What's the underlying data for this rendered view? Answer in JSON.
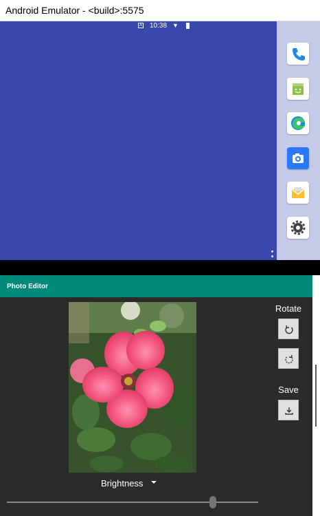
{
  "window": {
    "title": "Android Emulator - <build>:5575"
  },
  "status_bar": {
    "time": "10:38",
    "notification_glyph": "A",
    "icons": [
      "wifi-icon",
      "battery-icon"
    ]
  },
  "dock": {
    "apps": [
      {
        "name": "phone-app-icon",
        "color": "#1e88e5"
      },
      {
        "name": "store-app-icon",
        "color": "#8bc34a"
      },
      {
        "name": "edge-browser-app-icon",
        "color": "#0f8de0"
      },
      {
        "name": "camera-app-icon",
        "color": "#2979ff"
      },
      {
        "name": "mail-app-icon",
        "color": "#fbc02d"
      },
      {
        "name": "settings-app-icon",
        "color": "#424242"
      }
    ]
  },
  "app": {
    "title": "Photo Editor",
    "accent": "#00897b",
    "rotate_label": "Rotate",
    "save_label": "Save",
    "brightness_label": "Brightness",
    "brightness_value": 0.82
  },
  "colors": {
    "top_screen_bg": "#3949ab",
    "dock_bg": "#c5cae9",
    "editor_bg": "#2b2b2b"
  }
}
